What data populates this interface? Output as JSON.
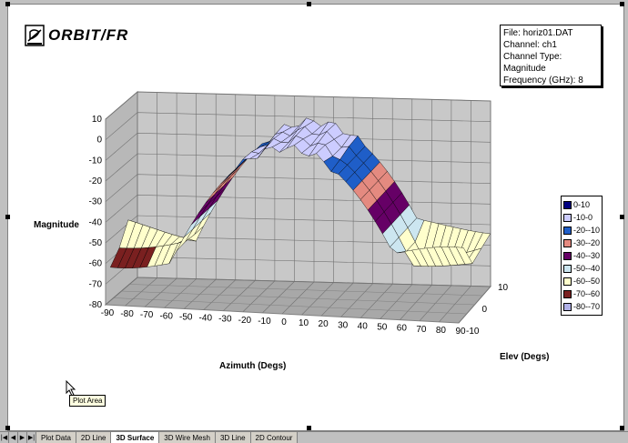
{
  "logo": {
    "text": "ORBIT/FR"
  },
  "info": [
    "File: horiz01.DAT",
    "Channel: ch1",
    "Channel Type: Magnitude",
    "Frequency (GHz): 8"
  ],
  "chart_data": {
    "type": "surface",
    "zlabel": "Magnitude",
    "xlabel": "Azimuth (Degs)",
    "ylabel": "Elev (Degs)",
    "z_ticks": [
      "10",
      "0",
      "-10",
      "-20",
      "-30",
      "-40",
      "-50",
      "-60",
      "-70",
      "-80"
    ],
    "x_ticks": [
      "-90",
      "-80",
      "-70",
      "-60",
      "-50",
      "-40",
      "-30",
      "-20",
      "-10",
      "0",
      "10",
      "20",
      "30",
      "40",
      "50",
      "60",
      "70",
      "80",
      "90"
    ],
    "y_ticks": [
      "10",
      "0",
      "-10"
    ],
    "zlim": [
      -80,
      10
    ],
    "legend": [
      {
        "label": "0-10",
        "color": "#000080"
      },
      {
        "label": "-10-0",
        "color": "#ccccff"
      },
      {
        "label": "-20--10",
        "color": "#1f5ec8"
      },
      {
        "label": "-30--20",
        "color": "#e48a80"
      },
      {
        "label": "-40--30",
        "color": "#660066"
      },
      {
        "label": "-50--40",
        "color": "#cce6f0"
      },
      {
        "label": "-60--50",
        "color": "#ffffcc"
      },
      {
        "label": "-70--60",
        "color": "#7a2020"
      },
      {
        "label": "-80--70",
        "color": "#b0b0e8"
      }
    ]
  },
  "tooltip": "Plot Area",
  "tabs": [
    {
      "label": "Plot Data",
      "active": false
    },
    {
      "label": "2D Line",
      "active": false
    },
    {
      "label": "3D Surface",
      "active": true
    },
    {
      "label": "3D Wire Mesh",
      "active": false
    },
    {
      "label": "3D Line",
      "active": false
    },
    {
      "label": "2D Contour",
      "active": false
    }
  ]
}
